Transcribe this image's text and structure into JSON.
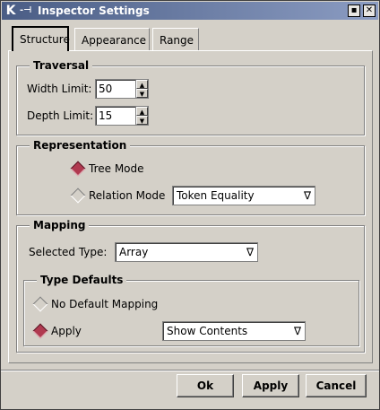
{
  "window": {
    "title": "Inspector Settings"
  },
  "titlebar_buttons": {
    "maximize": "▪",
    "close": "✕"
  },
  "tabs": [
    {
      "label": "Structure",
      "active": true
    },
    {
      "label": "Appearance",
      "active": false
    },
    {
      "label": "Range",
      "active": false
    }
  ],
  "traversal": {
    "title": "Traversal",
    "width_label": "Width Limit:",
    "width_value": "50",
    "depth_label": "Depth Limit:",
    "depth_value": "15"
  },
  "representation": {
    "title": "Representation",
    "tree_mode_label": "Tree Mode",
    "tree_mode_selected": true,
    "relation_mode_label": "Relation Mode",
    "relation_mode_selected": false,
    "relation_value": "Token Equality"
  },
  "mapping": {
    "title": "Mapping",
    "selected_type_label": "Selected Type:",
    "selected_type_value": "Array",
    "type_defaults": {
      "title": "Type Defaults",
      "no_default_label": "No Default Mapping",
      "no_default_selected": false,
      "apply_label": "Apply",
      "apply_selected": true,
      "apply_value": "Show Contents"
    }
  },
  "buttons": {
    "ok": "Ok",
    "apply": "Apply",
    "cancel": "Cancel"
  },
  "colors": {
    "titlebar_start": "#4a5d85",
    "titlebar_end": "#8b9cc2",
    "radio_on": "#b03a50",
    "face": "#d4d0c8"
  },
  "icons": {
    "app": "K",
    "pin": "-⊣",
    "dropdown": "∇",
    "spin_up": "▲",
    "spin_down": "▼"
  }
}
